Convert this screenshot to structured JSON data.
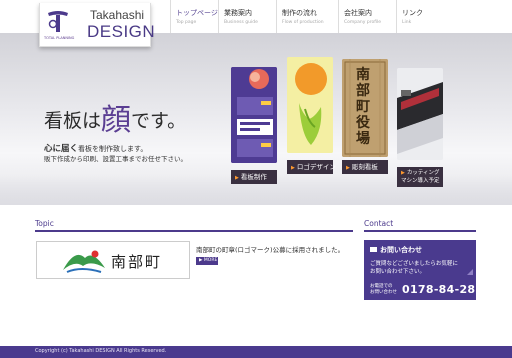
{
  "brand": {
    "name_line1": "Takahashi",
    "name_line2": "DESIGN",
    "sub": "TOTAL PLANNING",
    "accent": "#4c3a8c"
  },
  "nav": [
    {
      "label": "トップページ",
      "sub": "Top page"
    },
    {
      "label": "業務案内",
      "sub": "Business guide"
    },
    {
      "label": "制作の流れ",
      "sub": "Flow of production"
    },
    {
      "label": "会社案内",
      "sub": "Company profile"
    },
    {
      "label": "リンク",
      "sub": "Link"
    }
  ],
  "hero": {
    "title_pre": "看板は",
    "title_big": "顔",
    "title_post": "です。",
    "sub1_bold": "心に届く",
    "sub1_rest": "看板を制作致します。",
    "sub2": "販下作成から印刷、設置工事までお任せ下さい。",
    "products": [
      {
        "label": "看板制作",
        "icon": "signboard-image"
      },
      {
        "label": "ロゴデザイン",
        "icon": "logo-design-image"
      },
      {
        "label": "彫刻看板",
        "icon": "carved-sign-image"
      },
      {
        "label": "カッティングマシン導入予定",
        "icon": "cutting-machine-image"
      }
    ],
    "carved_text": "南部町役場"
  },
  "topic": {
    "heading": "Topic",
    "thumb_text": "南部町",
    "text": "南部町の町章(ロゴマーク)公募に採用されました。",
    "more": "▶ MORE"
  },
  "contact": {
    "heading": "Contact",
    "title": "お問い合わせ",
    "msg1": "ご質問などございましたらお気軽に",
    "msg2": "お問い合わせ下さい。",
    "tel_label1": "お電話での",
    "tel_label2": "お問い合わせ",
    "tel": "0178-84-2838"
  },
  "footer": {
    "copyright": "Copyright (c) Takahashi DESIGN All Rights Reserved."
  }
}
